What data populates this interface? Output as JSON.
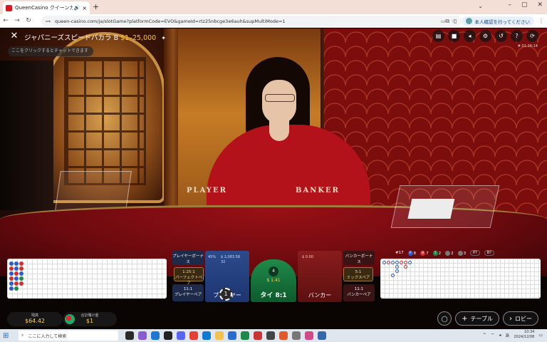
{
  "browser": {
    "tab_title": "QueenCasino クイーンカジノ |",
    "tab_sound_icon": "speaker-icon",
    "tab_close": "×",
    "new_tab": "+",
    "url": "queen-casino.com/ja/slotGame?platformCode=EVO&gameId=rtz25nbcge3e6auh&supMultiMode=1",
    "profile_label": "本人確認を行ってください",
    "window_controls": [
      "–",
      "▢",
      "✕"
    ]
  },
  "game": {
    "title": "ジャパニーズスピードバカラ B",
    "limits": "$1–25,000",
    "chat_placeholder": "ここをクリックするとチャットできます",
    "game_id": "# 01:34:14",
    "table_player": "PLAYER",
    "table_banker": "BANKER",
    "stats": {
      "round": "#17",
      "player": "8",
      "banker": "7",
      "tie": "2",
      "p_pair": "2",
      "b_pair": "3",
      "p_btn": "P?",
      "b_btn": "B?"
    },
    "bets": {
      "player_bonus": "プレイヤーボーナス",
      "perfect_pair_odds": "1:25:1",
      "perfect_pair": "パーフェクトペア",
      "player_pair_odds": "11:1",
      "player_pair": "プレイヤーペア",
      "player_pct": "45%",
      "player_amount": "$ 2,083.58",
      "player_count": "32",
      "player": "プレイヤー",
      "tie_count": "6",
      "tie_amount": "$ 1.41",
      "tie_chip": "4",
      "tie": "タイ 8:1",
      "banker_amount": "$ 0.00",
      "banker": "バンカー",
      "banker_bonus": "バンカーボーナス",
      "either_pair_odds": "5:1",
      "either_pair": "ミックスペア",
      "banker_pair_odds": "11:1",
      "banker_pair": "バンカーペア",
      "chip_value": "1"
    },
    "balance_label": "残高",
    "balance_value": "$64.42",
    "total_bet_label": "合計賭け金",
    "total_bet_value": "$1",
    "table_btn": "テーブル",
    "lobby_btn": "ロビー"
  },
  "taskbar": {
    "search_placeholder": "ここに入力して検索",
    "time": "10:34",
    "date": "2024/12/08",
    "ime": "あ"
  },
  "colors": {
    "player": "#2c4b8c",
    "banker": "#8a1c1c",
    "tie": "#1f8a4a",
    "accent": "#f7c632"
  }
}
